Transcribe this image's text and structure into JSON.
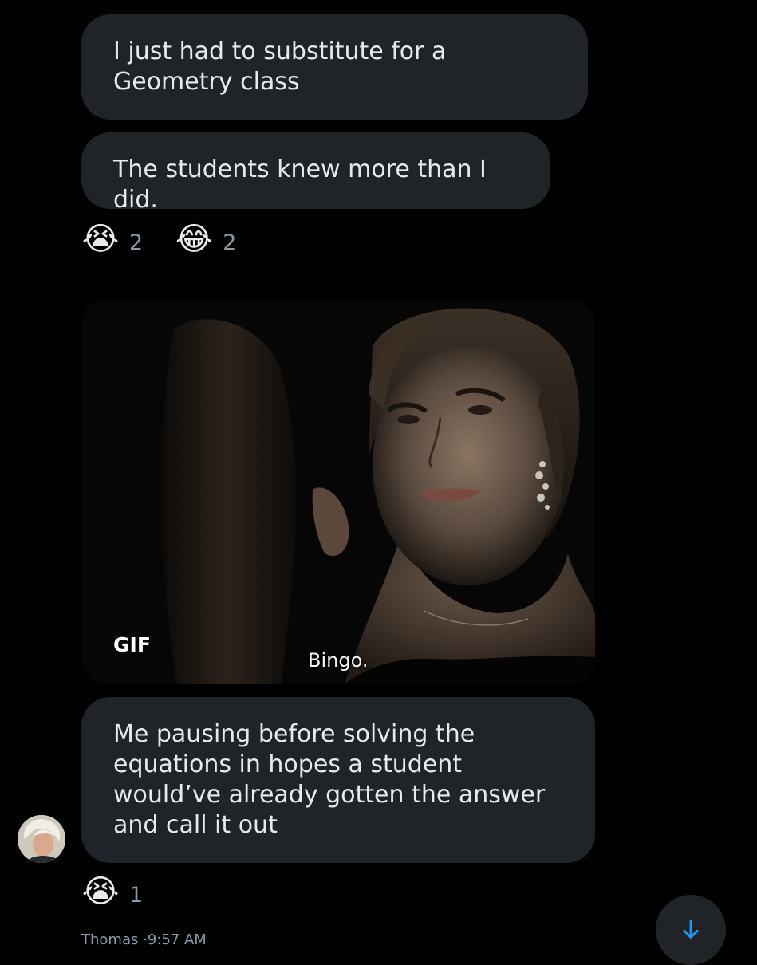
{
  "messages": [
    {
      "text": "I just had to substitute for a Geometry class"
    },
    {
      "text": "The students knew more than I did."
    },
    {
      "text": "Me pausing before solving the equations in hopes a student would’ve already gotten the answer and call it out"
    }
  ],
  "reactions_top": [
    {
      "emoji": "😭",
      "icon": "loudly-crying-face-icon",
      "count": "2"
    },
    {
      "emoji": "😂",
      "icon": "tears-of-joy-face-icon",
      "count": "2"
    }
  ],
  "gif": {
    "label": "GIF",
    "caption": "Bingo."
  },
  "reactions_bottom": [
    {
      "emoji": "😭",
      "icon": "loudly-crying-face-icon",
      "count": "1"
    }
  ],
  "footer": {
    "sender": "Thomas",
    "separator": "·",
    "time": "9:57 AM"
  },
  "colors": {
    "background": "#000000",
    "bubble": "#202327",
    "text": "#e7e9ea",
    "muted": "#8b98a5",
    "accent": "#1d9bf0"
  }
}
